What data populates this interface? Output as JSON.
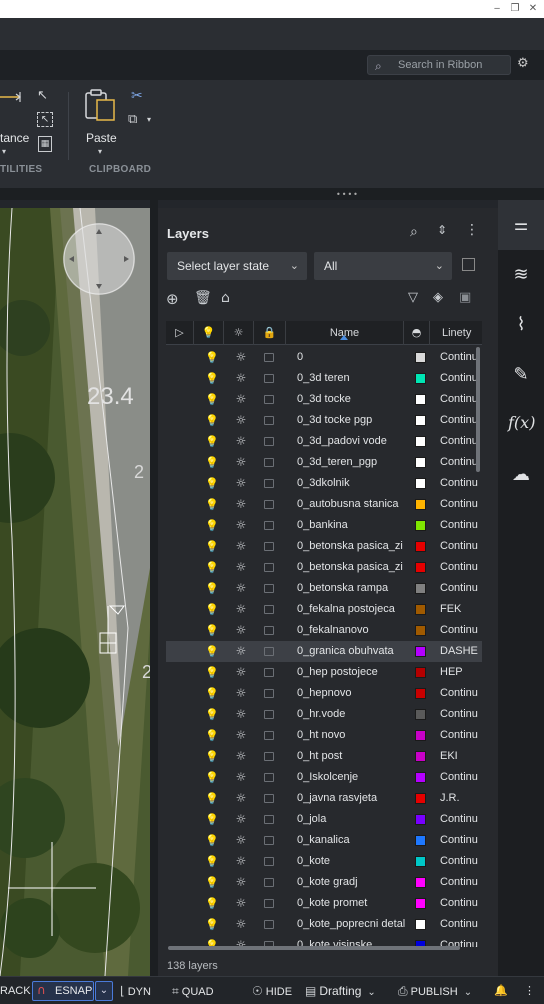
{
  "window": {
    "buttons": [
      {
        "icon": "minimize-icon",
        "glyph": "‒"
      },
      {
        "icon": "restore-icon",
        "glyph": "❐"
      },
      {
        "icon": "close-icon",
        "glyph": "✕"
      }
    ]
  },
  "ribbon": {
    "search_placeholder": "Search in Ribbon",
    "distance_label": "tance",
    "utilities_label": "TILITIES",
    "paste_label": "Paste",
    "clipboard_label": "CLIPBOARD"
  },
  "canvas": {
    "elevation_label": "23.4"
  },
  "layers": {
    "title": "Layers",
    "layer_state_placeholder": "Select layer state",
    "filter_value": "All",
    "columns": {
      "name": "Name",
      "linetype": "Linety"
    },
    "selected_index": 14,
    "items": [
      {
        "name": "0",
        "color": "#d9d9d9",
        "linetype": "Continu"
      },
      {
        "name": "0_3d teren",
        "color": "#00e6b4",
        "linetype": "Continu"
      },
      {
        "name": "0_3d tocke",
        "color": "#ffffff",
        "linetype": "Continu"
      },
      {
        "name": "0_3d tocke pgp",
        "color": "#ffffff",
        "linetype": "Continu"
      },
      {
        "name": "0_3d_padovi vode",
        "color": "#ffffff",
        "linetype": "Continu"
      },
      {
        "name": "0_3d_teren_pgp",
        "color": "#ffffff",
        "linetype": "Continu"
      },
      {
        "name": "0_3dkolnik",
        "color": "#ffffff",
        "linetype": "Continu"
      },
      {
        "name": "0_autobusna stanica",
        "color": "#ffb400",
        "linetype": "Continu"
      },
      {
        "name": "0_bankina",
        "color": "#7fe600",
        "linetype": "Continu"
      },
      {
        "name": "0_betonska pasica_zi",
        "color": "#e60000",
        "linetype": "Continu"
      },
      {
        "name": "0_betonska pasica_zi",
        "color": "#e60000",
        "linetype": "Continu"
      },
      {
        "name": "0_betonska rampa",
        "color": "#808080",
        "linetype": "Continu"
      },
      {
        "name": "0_fekalna postojeca",
        "color": "#a05a00",
        "linetype": "FEK"
      },
      {
        "name": "0_fekalnanovo",
        "color": "#a05a00",
        "linetype": "Continu"
      },
      {
        "name": "0_granica obuhvata",
        "color": "#b400ff",
        "linetype": "DASHE"
      },
      {
        "name": "0_hep postojece",
        "color": "#b40000",
        "linetype": "HEP"
      },
      {
        "name": "0_hepnovo",
        "color": "#c80000",
        "linetype": "Continu"
      },
      {
        "name": "0_hr.vode",
        "color": "#5a5a5a",
        "linetype": "Continu"
      },
      {
        "name": "0_ht novo",
        "color": "#c800c8",
        "linetype": "Continu"
      },
      {
        "name": "0_ht post",
        "color": "#c800c8",
        "linetype": "EKI"
      },
      {
        "name": "0_Iskolcenje",
        "color": "#b400ff",
        "linetype": "Continu"
      },
      {
        "name": "0_javna rasvjeta",
        "color": "#e60000",
        "linetype": "J.R."
      },
      {
        "name": "0_jola",
        "color": "#7800ff",
        "linetype": "Continu"
      },
      {
        "name": "0_kanalica",
        "color": "#1e78ff",
        "linetype": "Continu"
      },
      {
        "name": "0_kote",
        "color": "#00c8c8",
        "linetype": "Continu"
      },
      {
        "name": "0_kote gradj",
        "color": "#ff00ff",
        "linetype": "Continu"
      },
      {
        "name": "0_kote promet",
        "color": "#ff00ff",
        "linetype": "Continu"
      },
      {
        "name": "0_kote_poprecni detal",
        "color": "#ffffff",
        "linetype": "Continu"
      },
      {
        "name": "0_kote visinske",
        "color": "#0000dc",
        "linetype": "Continu"
      }
    ],
    "count_label": "138 layers"
  },
  "statusbar": {
    "track_label": "RACK",
    "esnap_label": "ESNAP",
    "dyn_label": "DYN",
    "quad_label": "QUAD",
    "hide_label": "HIDE",
    "workspace_label": "Drafting",
    "publish_label": "PUBLISH"
  }
}
